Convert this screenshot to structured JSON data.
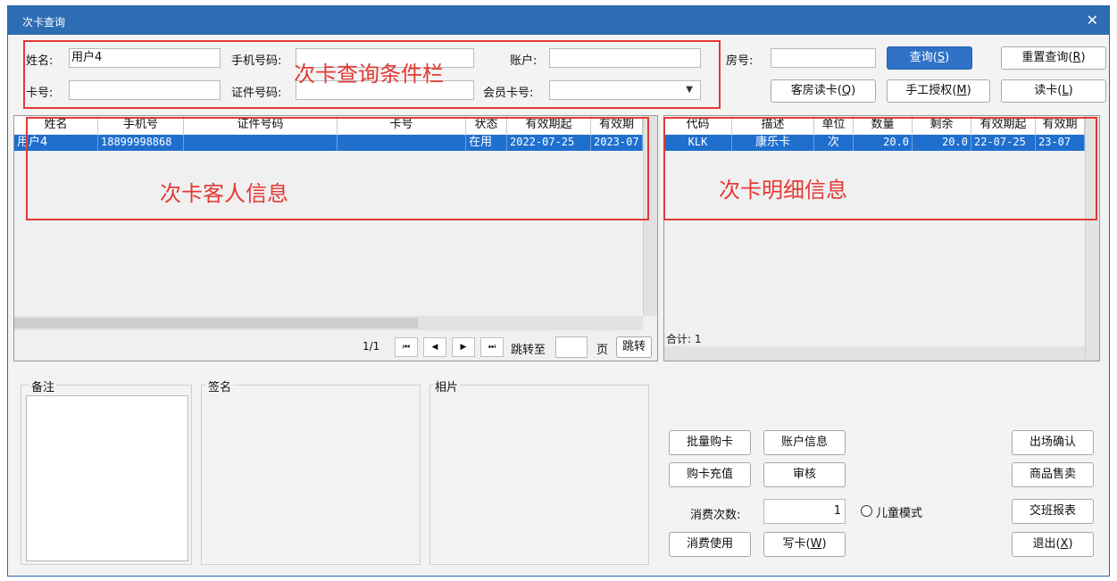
{
  "window": {
    "title": "次卡查询",
    "close_glyph": "✕"
  },
  "search": {
    "name_label": "姓名:",
    "name_value": "用户4",
    "phone_label": "手机号码:",
    "phone_value": "",
    "account_label": "账户:",
    "account_value": "",
    "room_label": "房号:",
    "room_value": "",
    "card_label": "卡号:",
    "card_value": "",
    "id_label": "证件号码:",
    "id_value": "",
    "member_label": "会员卡号:",
    "member_value": ""
  },
  "buttons": {
    "query": "查询",
    "query_key": "S",
    "reset": "重置查询",
    "reset_key": "R",
    "room_read": "客房读卡",
    "room_read_key": "Q",
    "manual_auth": "手工授权",
    "manual_auth_key": "M",
    "read_card": "读卡",
    "read_card_key": "L"
  },
  "customer_table": {
    "columns": [
      "姓名",
      "手机号",
      "证件号码",
      "卡号",
      "状态",
      "有效期起",
      "有效期"
    ],
    "rows": [
      [
        "用户4",
        "18899998868",
        "",
        "",
        "在用",
        "2022-07-25",
        "2023-07"
      ]
    ]
  },
  "detail_table": {
    "columns": [
      "代码",
      "描述",
      "单位",
      "数量",
      "剩余",
      "有效期起",
      "有效期"
    ],
    "rows": [
      [
        "KLK",
        "康乐卡",
        "次",
        "20.0",
        "20.0",
        "22-07-25",
        "23-07"
      ]
    ],
    "total_label": "合计: 1"
  },
  "pager": {
    "page_info": "1/1",
    "first_glyph": "⏮",
    "prev_glyph": "◀",
    "next_glyph": "▶",
    "last_glyph": "⏭",
    "goto_label": "跳转至",
    "page_value": "",
    "page_unit": "页",
    "jump_button": "跳转"
  },
  "groups": {
    "remark": "备注",
    "signature": "签名",
    "photo": "相片"
  },
  "actions": {
    "batch_buy": "批量购卡",
    "account_info": "账户信息",
    "exit_confirm": "出场确认",
    "recharge": "购卡充值",
    "audit": "审核",
    "goods_sale": "商品售卖",
    "consume_count_label": "消费次数:",
    "consume_count_value": "1",
    "child_mode": "儿童模式",
    "shift_report": "交班报表",
    "consume_use": "消费使用",
    "write_card": "写卡",
    "write_card_key": "W",
    "exit": "退出",
    "exit_key": "X"
  },
  "annotations": {
    "conditions": "次卡查询条件栏",
    "customer_info": "次卡客人信息",
    "card_detail": "次卡明细信息"
  },
  "colors": {
    "titlebar": "#2d6db4",
    "selection": "#1f6fce",
    "primary_button": "#2f72c7",
    "annotation_red": "#e53935"
  }
}
